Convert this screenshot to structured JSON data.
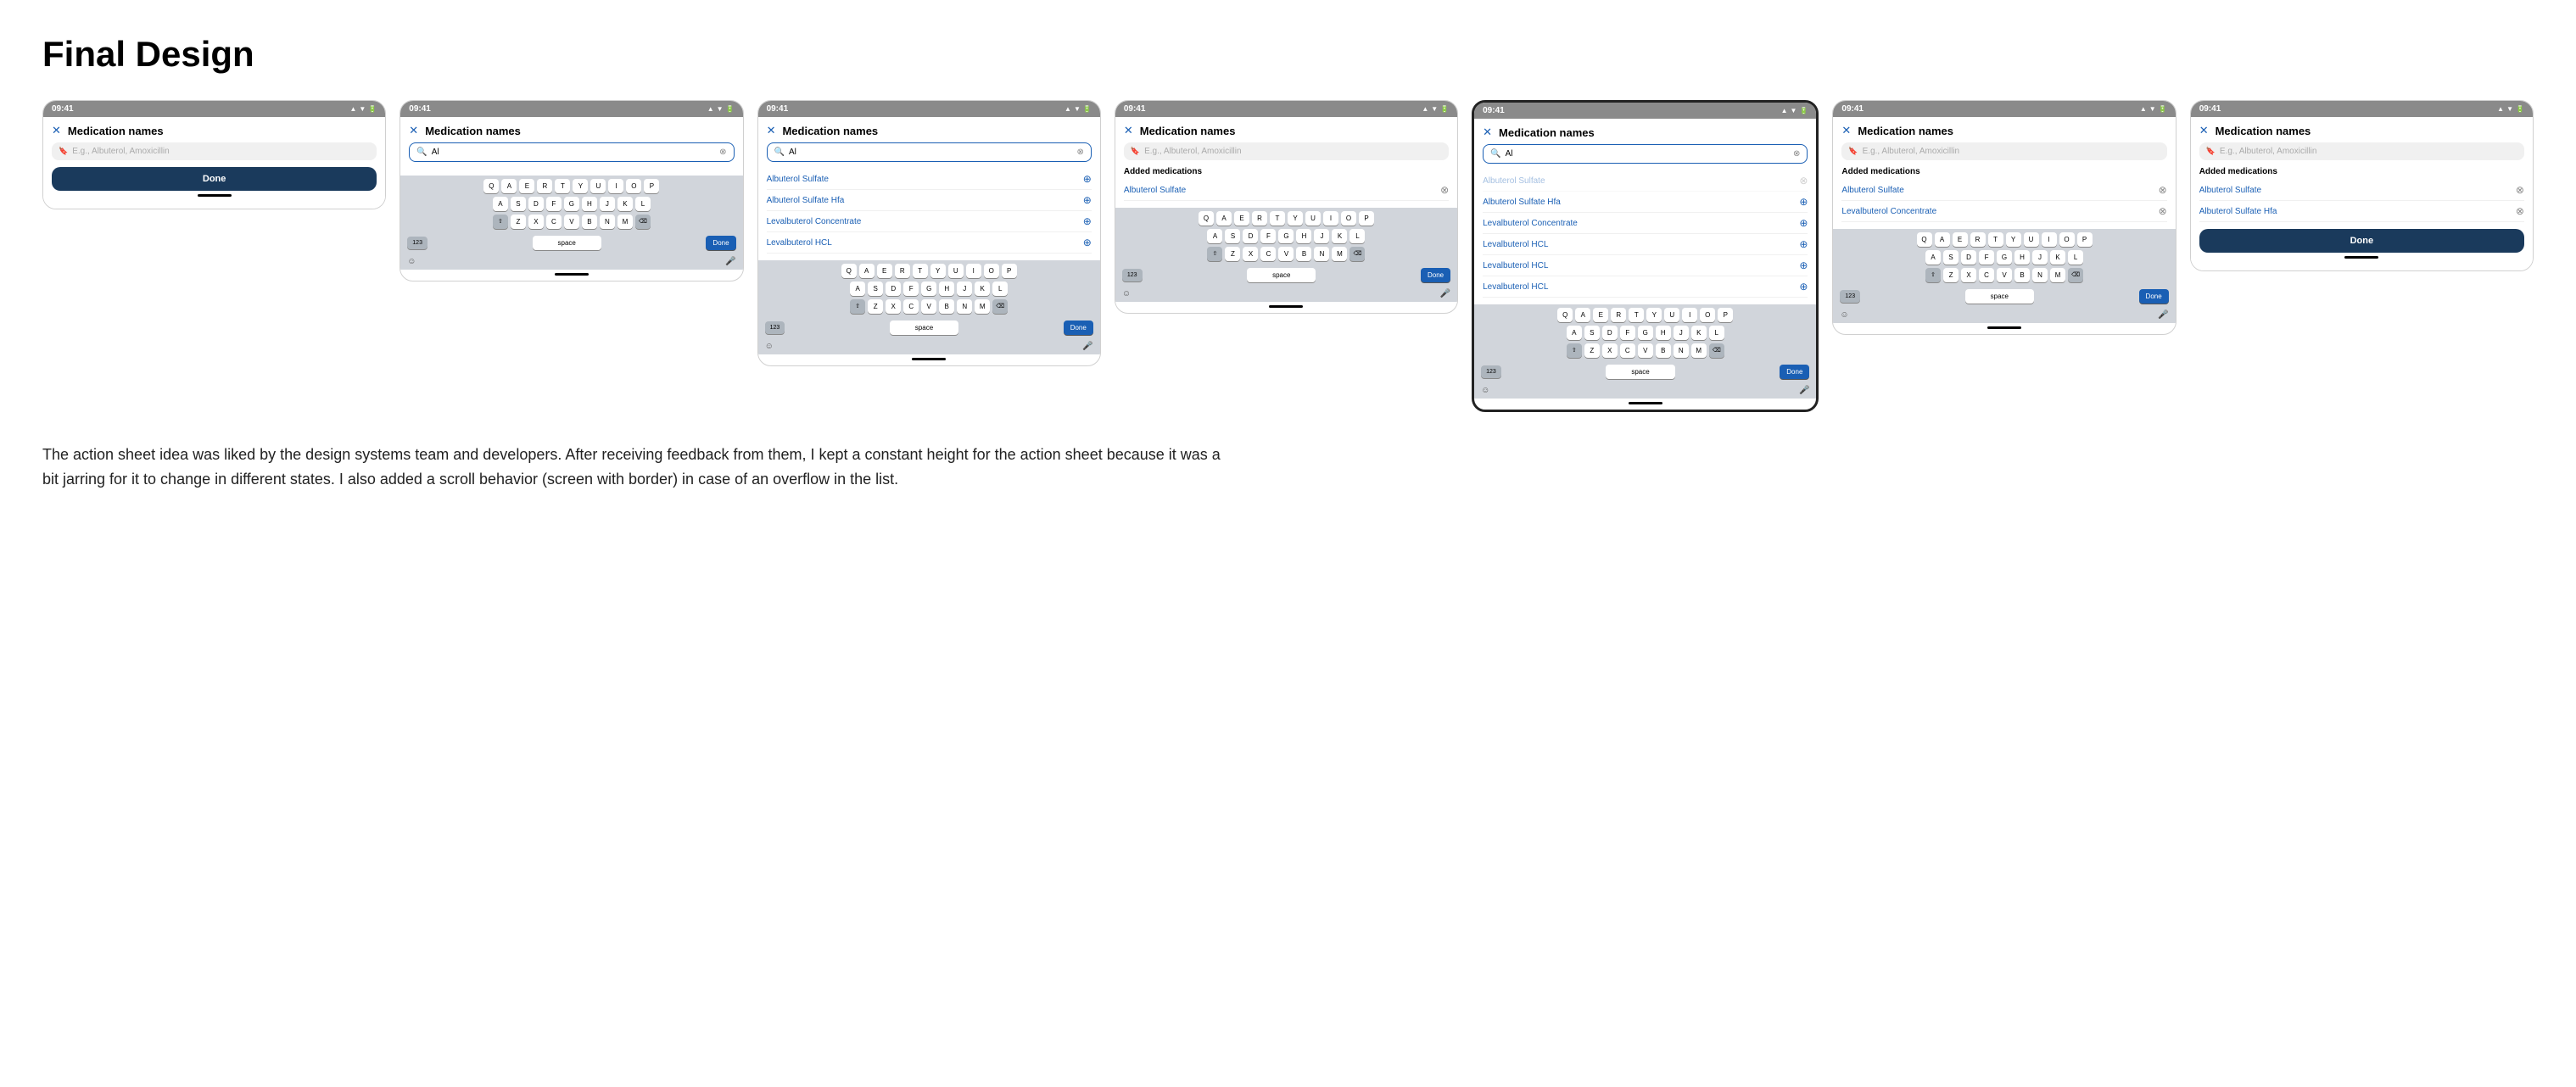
{
  "page": {
    "title": "Final Design",
    "description": "The action sheet idea was liked by the design systems team and developers. After receiving feedback from them, I kept a constant height for the action sheet because it was a bit jarring for it to change in different states. I also added a scroll behavior (screen with border) in case of an overflow in the list."
  },
  "phones": [
    {
      "id": "phone1",
      "highlighted": false,
      "statusBar": {
        "time": "09:41",
        "icons": "▲ ◀ ◀"
      },
      "header": {
        "closeLabel": "✕",
        "title": "Medication names"
      },
      "searchBar": {
        "type": "placeholder",
        "placeholder": "E.g., Albuterol, Amoxicillin",
        "active": false
      },
      "sections": [],
      "hasDoneBtn": true,
      "doneBtnLabel": "Done",
      "hasKeyboard": false
    },
    {
      "id": "phone2",
      "highlighted": false,
      "statusBar": {
        "time": "09:41",
        "icons": "▲ ◀ ◀"
      },
      "header": {
        "closeLabel": "✕",
        "title": "Medication names"
      },
      "searchBar": {
        "type": "text",
        "text": "Al",
        "active": true
      },
      "sections": [],
      "hasDoneBtn": false,
      "hasKeyboard": true
    },
    {
      "id": "phone3",
      "highlighted": false,
      "statusBar": {
        "time": "09:41",
        "icons": "▲ ◀ ◀"
      },
      "header": {
        "closeLabel": "✕",
        "title": "Medication names"
      },
      "searchBar": {
        "type": "text",
        "text": "Al",
        "active": true
      },
      "sections": [
        {
          "label": "",
          "items": [
            {
              "name": "Albuterol Sulfate",
              "action": "add"
            },
            {
              "name": "Albuterol Sulfate Hfa",
              "action": "add"
            },
            {
              "name": "Levalbuterol Concentrate",
              "action": "add"
            },
            {
              "name": "Levalbuterol HCL",
              "action": "add"
            }
          ]
        }
      ],
      "hasDoneBtn": false,
      "hasKeyboard": true
    },
    {
      "id": "phone4",
      "highlighted": false,
      "statusBar": {
        "time": "09:41",
        "icons": "▲ ◀ ◀"
      },
      "header": {
        "closeLabel": "✕",
        "title": "Medication names"
      },
      "searchBar": {
        "type": "placeholder",
        "placeholder": "E.g., Albuterol, Amoxicillin",
        "active": false
      },
      "sections": [
        {
          "label": "Added medications",
          "items": [
            {
              "name": "Albuterol Sulfate",
              "action": "remove"
            }
          ]
        }
      ],
      "hasDoneBtn": false,
      "hasKeyboard": true
    },
    {
      "id": "phone5",
      "highlighted": true,
      "statusBar": {
        "time": "09:41",
        "icons": "▲ ◀ ◀"
      },
      "header": {
        "closeLabel": "✕",
        "title": "Medication names"
      },
      "searchBar": {
        "type": "text",
        "text": "Al",
        "active": true
      },
      "sections": [
        {
          "label": "",
          "items": [
            {
              "name": "Albuterol Sulfate",
              "action": "add",
              "faded": true
            },
            {
              "name": "Albuterol Sulfate Hfa",
              "action": "add"
            },
            {
              "name": "Levalbuterol Concentrate",
              "action": "add"
            },
            {
              "name": "Levalbuterol HCL",
              "action": "add"
            },
            {
              "name": "Levalbuterol HCL",
              "action": "add"
            },
            {
              "name": "Levalbuterol HCL",
              "action": "add"
            }
          ]
        }
      ],
      "hasDoneBtn": false,
      "hasKeyboard": true
    },
    {
      "id": "phone6",
      "highlighted": false,
      "statusBar": {
        "time": "09:41",
        "icons": "▲ ◀ ◀"
      },
      "header": {
        "closeLabel": "✕",
        "title": "Medication names"
      },
      "searchBar": {
        "type": "placeholder",
        "placeholder": "E.g., Albuterol, Amoxicillin",
        "active": false
      },
      "sections": [
        {
          "label": "Added medications",
          "items": [
            {
              "name": "Albuterol Sulfate",
              "action": "remove"
            },
            {
              "name": "Levalbuterol Concentrate",
              "action": "remove"
            }
          ]
        }
      ],
      "hasDoneBtn": false,
      "hasKeyboard": true
    },
    {
      "id": "phone7",
      "highlighted": false,
      "statusBar": {
        "time": "09:41",
        "icons": "▲ ◀ ◀"
      },
      "header": {
        "closeLabel": "✕",
        "title": "Medication names"
      },
      "searchBar": {
        "type": "placeholder",
        "placeholder": "E.g., Albuterol, Amoxicillin",
        "active": false
      },
      "sections": [
        {
          "label": "Added medications",
          "items": [
            {
              "name": "Albuterol Sulfate",
              "action": "remove"
            },
            {
              "name": "Albuterol Sulfate Hfa",
              "action": "remove"
            }
          ]
        }
      ],
      "hasDoneBtn": true,
      "doneBtnLabel": "Done",
      "hasKeyboard": false
    }
  ],
  "keyboard": {
    "rows": [
      [
        "Q",
        "A",
        "E",
        "R",
        "T",
        "Y",
        "U",
        "I",
        "O",
        "P"
      ],
      [
        "A",
        "S",
        "D",
        "F",
        "G",
        "H",
        "J",
        "K",
        "L"
      ],
      [
        "⇧",
        "Z",
        "X",
        "C",
        "V",
        "B",
        "N",
        "M",
        "⌫"
      ],
      [
        "123",
        "space",
        "Done"
      ]
    ]
  }
}
